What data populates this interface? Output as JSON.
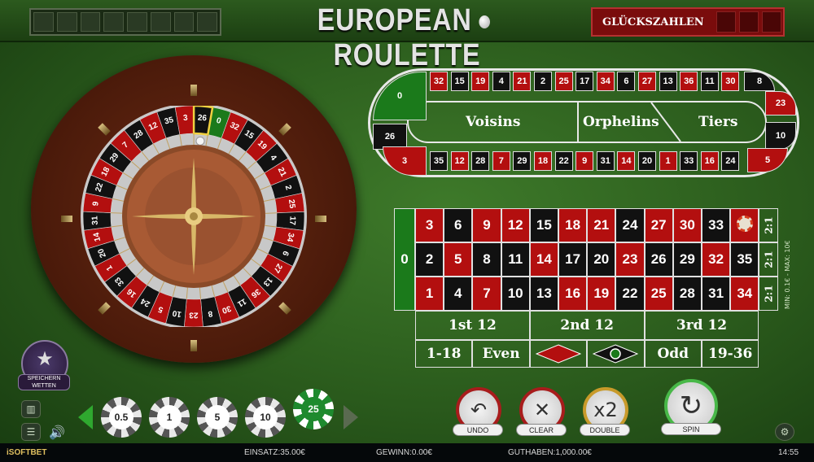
{
  "header": {
    "title_left": "EUROPEAN",
    "title_right": "ROULETTE",
    "lucky_label": "GLÜCKSZAHLEN"
  },
  "wheel": {
    "order": [
      "0",
      "32",
      "15",
      "19",
      "4",
      "21",
      "2",
      "25",
      "17",
      "34",
      "6",
      "27",
      "13",
      "36",
      "11",
      "30",
      "8",
      "23",
      "10",
      "5",
      "24",
      "16",
      "33",
      "1",
      "20",
      "14",
      "31",
      "9",
      "22",
      "18",
      "29",
      "7",
      "28",
      "12",
      "35",
      "3",
      "26"
    ],
    "highlight": "26"
  },
  "racetrack": {
    "top": [
      "32",
      "15",
      "19",
      "4",
      "21",
      "2",
      "25",
      "17",
      "34",
      "6",
      "27",
      "13",
      "36",
      "11",
      "30"
    ],
    "bottom": [
      "35",
      "12",
      "28",
      "7",
      "29",
      "18",
      "22",
      "9",
      "31",
      "14",
      "20",
      "1",
      "33",
      "16",
      "24"
    ],
    "left": [
      "0",
      "26",
      "3"
    ],
    "right": [
      "8",
      "23",
      "10",
      "5"
    ],
    "sections": {
      "voisins": "Voisins",
      "orphelins": "Orphelins",
      "tiers": "Tiers"
    }
  },
  "table": {
    "zero": "0",
    "rows": [
      [
        "3",
        "6",
        "9",
        "12",
        "15",
        "18",
        "21",
        "24",
        "27",
        "30",
        "33",
        "36"
      ],
      [
        "2",
        "5",
        "8",
        "11",
        "14",
        "17",
        "20",
        "23",
        "26",
        "29",
        "32",
        "35"
      ],
      [
        "1",
        "4",
        "7",
        "10",
        "13",
        "16",
        "19",
        "22",
        "25",
        "28",
        "31",
        "34"
      ]
    ],
    "reds": [
      "1",
      "3",
      "5",
      "7",
      "9",
      "12",
      "14",
      "16",
      "18",
      "19",
      "21",
      "23",
      "25",
      "27",
      "30",
      "32",
      "34",
      "36"
    ],
    "column_label": "2:1",
    "dozens": [
      "1st 12",
      "2nd 12",
      "3rd 12"
    ],
    "outside": {
      "low": "1-18",
      "even": "Even",
      "odd": "Odd",
      "high": "19-36"
    },
    "limits": "MIN: 0.1€ - MAX: 10€"
  },
  "chips": [
    "0.5",
    "1",
    "5",
    "10",
    "25"
  ],
  "selected_chip": "25",
  "buttons": {
    "undo": "UNDO",
    "clear": "CLEAR",
    "double": "DOUBLE",
    "double_icon": "x2",
    "spin": "SPIN"
  },
  "favourite": {
    "label_1": "SPEICHERN",
    "label_2": "WETTEN"
  },
  "status": {
    "brand": "iSOFTBET",
    "stake": "EINSATZ:35.00€",
    "win": "GEWINN:0.00€",
    "balance": "GUTHABEN:1,000.00€",
    "time": "14:55"
  },
  "colors": {
    "red": "#b30f0f",
    "black": "#111111",
    "green": "#1b7a1b",
    "felt": "#2f6420"
  }
}
